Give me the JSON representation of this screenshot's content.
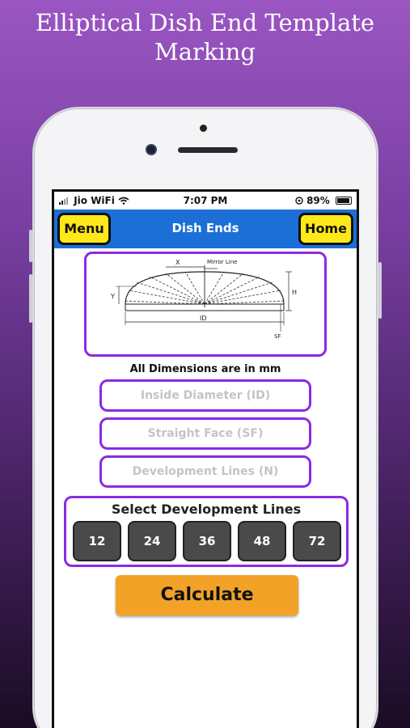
{
  "promo": {
    "title_line1": "Elliptical Dish End Template",
    "title_line2": "Marking"
  },
  "status_bar": {
    "carrier": "Jio WiFi",
    "time": "7:07 PM",
    "battery": "89%"
  },
  "header": {
    "menu_label": "Menu",
    "title": "Dish Ends",
    "home_label": "Home"
  },
  "diagram": {
    "label_x": "X",
    "label_mirror": "Mirror Line",
    "label_y": "Y",
    "label_h": "H",
    "label_id": "ID",
    "label_sf": "SF"
  },
  "note": "All Dimensions are in mm",
  "inputs": {
    "inside_diameter_placeholder": "Inside Diameter (ID)",
    "straight_face_placeholder": "Straight Face (SF)",
    "development_lines_placeholder": "Development Lines (N)"
  },
  "selector": {
    "label": "Select Development Lines",
    "options": [
      "12",
      "24",
      "36",
      "48",
      "72"
    ]
  },
  "calculate_label": "Calculate",
  "colors": {
    "accent_purple": "#8a2be2",
    "nav_blue": "#1c6fd6",
    "nav_button_yellow": "#ffe81a",
    "calculate_orange": "#f2a227",
    "option_gray": "#4a4a4c"
  }
}
